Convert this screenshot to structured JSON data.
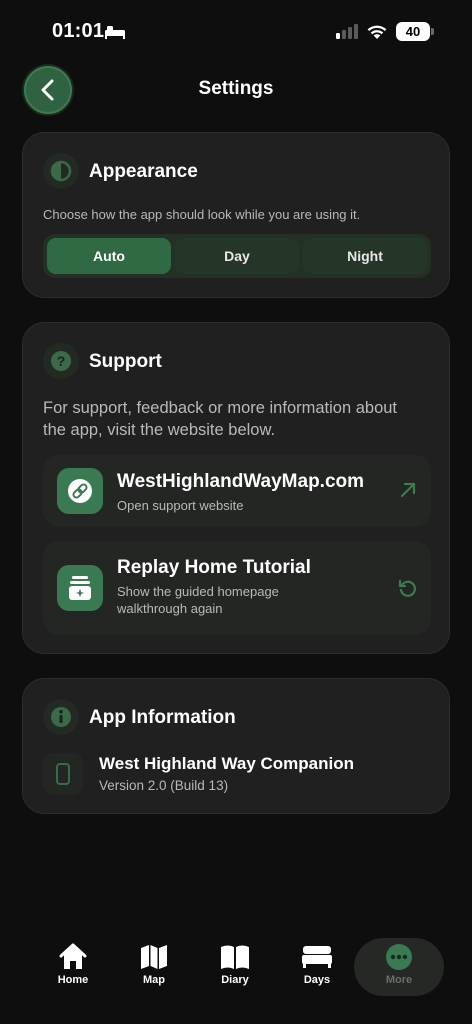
{
  "status_bar": {
    "time": "01:01",
    "battery": "40"
  },
  "header": {
    "title": "Settings"
  },
  "appearance": {
    "title": "Appearance",
    "description": "Choose how the app should look while you are using it.",
    "options": [
      {
        "label": "Auto",
        "selected": true
      },
      {
        "label": "Day",
        "selected": false
      },
      {
        "label": "Night",
        "selected": false
      }
    ]
  },
  "support": {
    "title": "Support",
    "description_line1": "For support, feedback or more information about",
    "description_line2": "the app, visit the website below.",
    "website": {
      "title": "WestHighlandWayMap.com",
      "subtitle": "Open support website"
    },
    "tutorial": {
      "title": "Replay Home Tutorial",
      "subtitle_line1": "Show the guided homepage",
      "subtitle_line2": "walkthrough again"
    }
  },
  "app_info": {
    "title": "App Information",
    "app_name": "West Highland Way Companion",
    "version": "Version 2.0 (Build 13)"
  },
  "tabs": [
    {
      "label": "Home",
      "icon": "home-icon"
    },
    {
      "label": "Map",
      "icon": "map-icon"
    },
    {
      "label": "Diary",
      "icon": "book-icon"
    },
    {
      "label": "Days",
      "icon": "bed-icon"
    },
    {
      "label": "More",
      "icon": "more-icon",
      "active": true
    }
  ],
  "colors": {
    "accent": "#2f6a44",
    "background": "#0d0e0d",
    "card": "#1f201f"
  }
}
